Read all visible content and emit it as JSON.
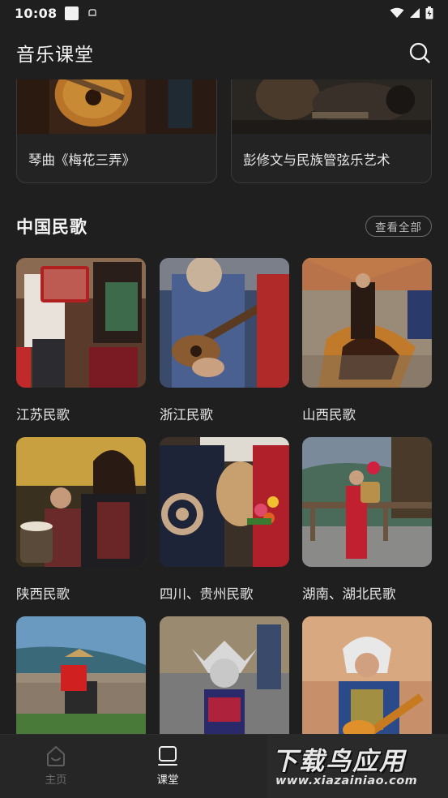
{
  "status_bar": {
    "time": "10:08"
  },
  "app_bar": {
    "title": "音乐课堂"
  },
  "top_cards": [
    {
      "label": "琴曲《梅花三弄》"
    },
    {
      "label": "彭修文与民族管弦乐艺术"
    }
  ],
  "section": {
    "title": "中国民歌",
    "view_all": "查看全部",
    "items": [
      {
        "label": "江苏民歌"
      },
      {
        "label": "浙江民歌"
      },
      {
        "label": "山西民歌"
      },
      {
        "label": "陕西民歌"
      },
      {
        "label": "四川、贵州民歌"
      },
      {
        "label": "湖南、湖北民歌"
      },
      {
        "label": ""
      },
      {
        "label": ""
      },
      {
        "label": ""
      }
    ]
  },
  "bottom_nav": {
    "home_label": "主页",
    "class_label": "课堂"
  },
  "watermark": {
    "title": "下载鸟应用",
    "url": "www.xiazainiao.com"
  }
}
